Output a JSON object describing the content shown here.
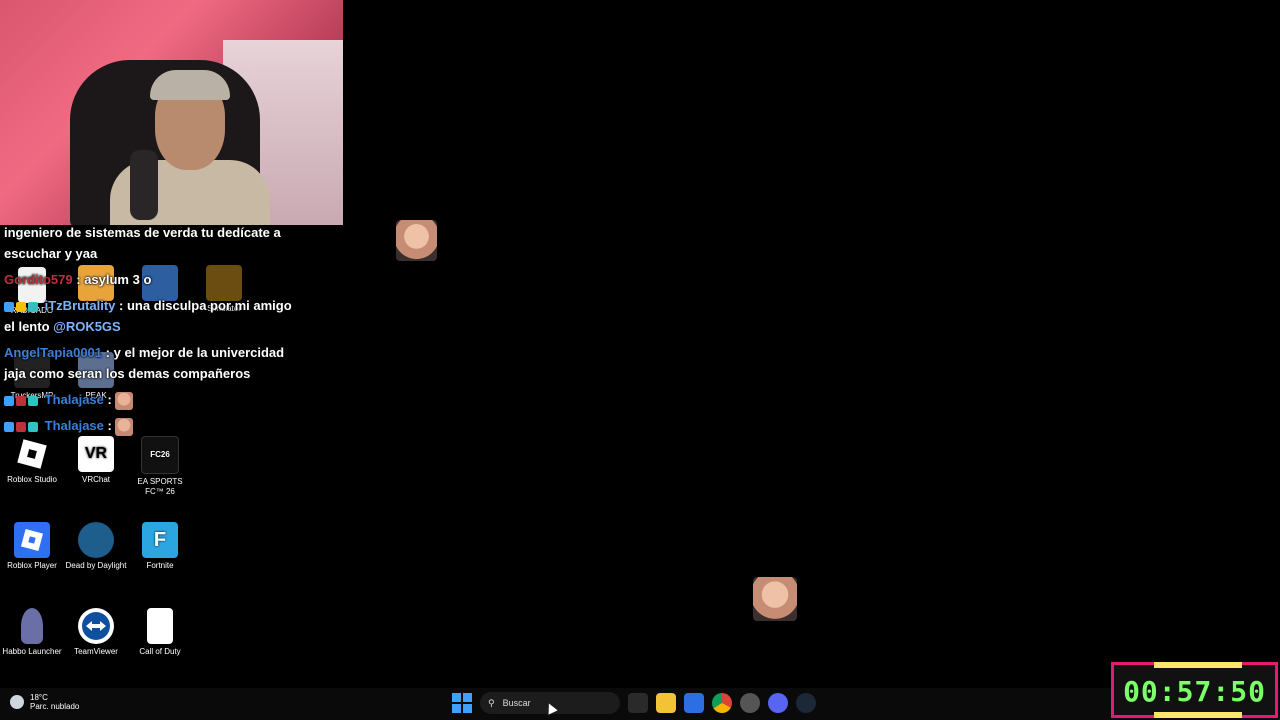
{
  "chat": {
    "msg1": {
      "text": "ingeniero de sistemas de verda tu dedícate a escuchar y yaa"
    },
    "msg2": {
      "user": "Gordito579",
      "text": ": asylum 3 o",
      "user_color": "#c0303a"
    },
    "msg3": {
      "user": "iTzBrutality",
      "text": ": una disculpa por mi amigo el lento",
      "mention": "@ROK5GS",
      "user_color": "#7fb3ff"
    },
    "msg4": {
      "user": "AngelTapia0001",
      "text": ": y el mejor de la univercidad jaja como seran los demas compañeros",
      "user_color": "#3b7fd6"
    },
    "msg5": {
      "user": "Thalajase",
      "text": ":",
      "user_color": "#3b7fd6"
    },
    "msg6": {
      "user": "Thalajase",
      "text": ":",
      "user_color": "#3b7fd6"
    }
  },
  "desktop": {
    "radicado": "RADICADO",
    "gold_mining": "Simulator",
    "peak": "PEAK",
    "truckers": "TruckersMP",
    "roblox_studio": "Roblox Studio",
    "vrchat": "VRChat",
    "vrchat_glyph": "VR",
    "ea_fc": "EA SPORTS FC™ 26",
    "ea_fc_glyph": "FC26",
    "roblox_player": "Roblox Player",
    "dead_by_daylight": "Dead by Daylight",
    "fortnite": "Fortnite",
    "fortnite_glyph": "F",
    "habbo": "Habbo Launcher",
    "teamviewer": "TeamViewer",
    "call_of_duty": "Call of Duty"
  },
  "taskbar": {
    "temperature": "18°C",
    "weather": "Parc. nublado",
    "search_label": "Buscar"
  },
  "timer": {
    "value": "00:57:50"
  },
  "colors": {
    "timer_green": "#7dff6a",
    "timer_border": "#e21b73",
    "accent_blue": "#3ea0ff"
  }
}
